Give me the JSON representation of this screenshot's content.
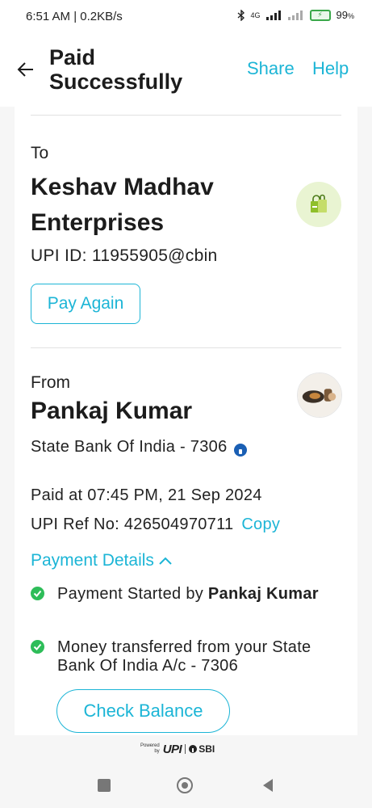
{
  "status_bar": {
    "time": "6:51 AM | 0.2KB/s",
    "network_label": "4G",
    "battery_percent": "99",
    "battery_percent_suffix": "%"
  },
  "header": {
    "title": "Paid Successfully",
    "share_label": "Share",
    "help_label": "Help"
  },
  "payee": {
    "to_label": "To",
    "name": "Keshav Madhav Enterprises",
    "upi_id": "UPI ID: 11955905@cbin",
    "pay_again_label": "Pay Again"
  },
  "payer": {
    "from_label": "From",
    "name": "Pankaj Kumar",
    "bank": "State Bank Of India - 7306"
  },
  "transaction": {
    "paid_at": "Paid at 07:45 PM, 21 Sep 2024",
    "ref_prefix": "UPI Ref No: 426504970711",
    "copy_label": "Copy"
  },
  "details": {
    "toggle_label": "Payment Details",
    "step1_prefix": "Payment Started by ",
    "step1_name": "Pankaj Kumar",
    "step2_text": "Money transferred from your State Bank Of India A/c - 7306",
    "check_balance_label": "Check Balance"
  },
  "footer": {
    "powered_line1": "Powered",
    "powered_line2": "by",
    "upi_logo": "UPI",
    "sbi_logo": "SBI"
  },
  "colors": {
    "accent": "#1cb5d6",
    "success": "#2ebd59"
  },
  "icons": [
    "back-arrow-icon",
    "bluetooth-icon",
    "signal-icon",
    "battery-icon",
    "shopping-bag-icon",
    "check-icon",
    "chevron-up-icon"
  ]
}
